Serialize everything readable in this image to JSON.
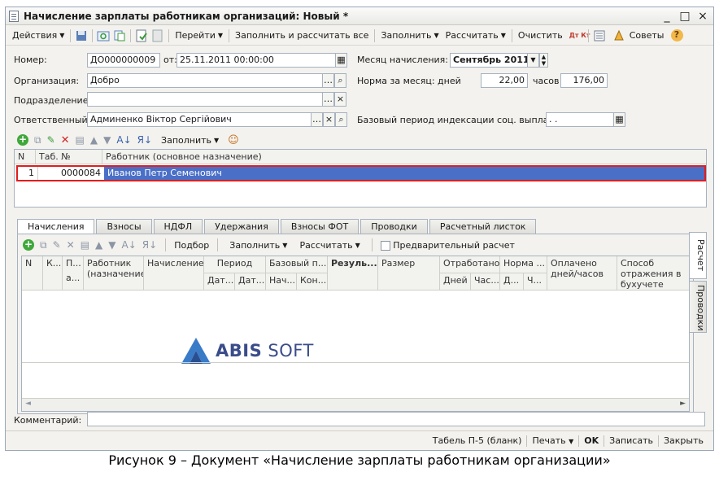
{
  "window": {
    "title": "Начисление зарплаты работникам организаций: Новый *",
    "controls": [
      "_",
      "□",
      "×"
    ]
  },
  "toolbar": {
    "actions": "Действия",
    "goto": "Перейти",
    "fill_calc_all": "Заполнить и рассчитать все",
    "fill": "Заполнить",
    "calculate": "Рассчитать",
    "clear": "Очистить",
    "dt_kt": "Дт Кт",
    "tips": "Советы",
    "help": "?"
  },
  "header": {
    "number_label": "Номер:",
    "number_value": "ДО000000009",
    "from_label": "от:",
    "date_value": "25.11.2011 00:00:00",
    "org_label": "Организация:",
    "org_value": "Добро",
    "dept_label": "Подразделение:",
    "dept_value": "",
    "resp_label": "Ответственный:",
    "resp_value": "Админенко Віктор Сергійович",
    "month_label": "Месяц начисления:",
    "month_value": "Сентябрь 2011",
    "norm_label": "Норма за месяц: дней",
    "norm_days": "22,00",
    "hours_label": "часов",
    "norm_hours": "176,00",
    "base_period_label": "Базовый период индексации соц. выплат:",
    "base_period_value": ". ."
  },
  "employees_toolbar": {
    "fill": "Заполнить"
  },
  "employees_grid": {
    "columns": [
      "N",
      "Таб. №",
      "Работник (основное назначение)"
    ],
    "rows": [
      {
        "n": "1",
        "tab": "0000084",
        "name": "Иванов Петр Семенович"
      }
    ]
  },
  "tabs": [
    "Начисления",
    "Взносы",
    "НДФЛ",
    "Удержания",
    "Взносы ФОТ",
    "Проводки",
    "Расчетный листок"
  ],
  "side_tabs": [
    "Расчет",
    "Проводки"
  ],
  "accruals_toolbar": {
    "select": "Подбор",
    "fill": "Заполнить",
    "calculate": "Рассчитать",
    "preliminary": "Предварительный расчет"
  },
  "accruals_grid": {
    "h_n": "N",
    "h_k": "К...",
    "h_p": "П...",
    "h_a": "а...",
    "h_worker": "Работник (назначение)",
    "h_accrual": "Начисление",
    "h_period": "Период",
    "h_period_from": "Дат...",
    "h_period_to": "Дат...",
    "h_base": "Базовый п...",
    "h_base_start": "Нач...",
    "h_base_end": "Кон...",
    "h_result": "Резуль...",
    "h_size": "Размер",
    "h_worked": "Отработано",
    "h_worked_days": "Дней",
    "h_worked_hours": "Час...",
    "h_norm": "Норма ...",
    "h_norm_d": "Д...",
    "h_norm_h": "Ч...",
    "h_paid": "Оплачено дней/часов",
    "h_method": "Способ отражения в бухучете"
  },
  "logo": {
    "brand_bold": "ABIS",
    "brand_rest": " SOFT",
    "color": "#3a4c8a"
  },
  "comment": {
    "label": "Комментарий:",
    "value": ""
  },
  "statusbar": {
    "tabel": "Табель П-5 (бланк)",
    "print": "Печать",
    "ok": "OK",
    "save": "Записать",
    "close": "Закрыть"
  },
  "caption": "Рисунок 9 – Документ «Начисление зарплаты работникам организации»",
  "colors": {
    "selected_row": "#4a6fc7",
    "highlight_border": "#e11d1d"
  }
}
